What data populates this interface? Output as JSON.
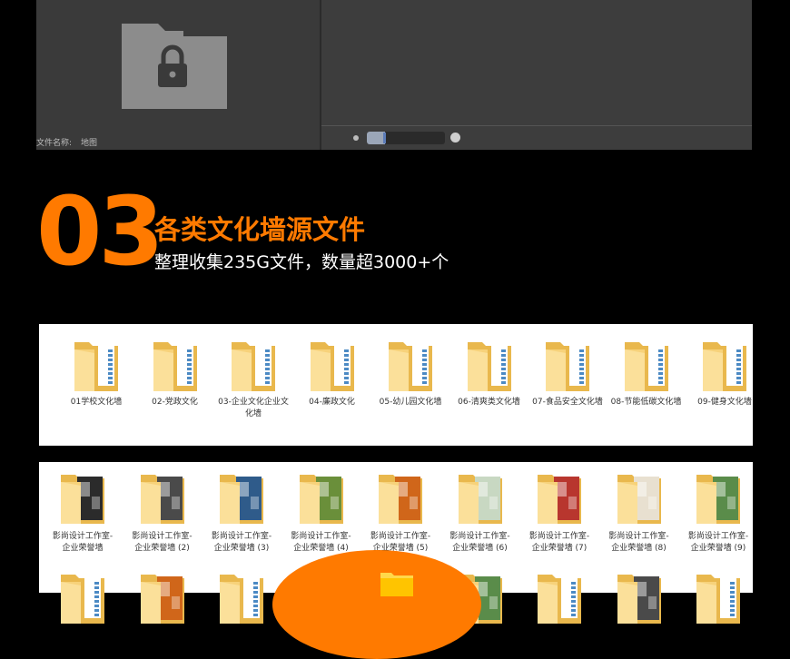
{
  "preview": {
    "filename_label": "文件名称:",
    "filename_value": "地图"
  },
  "heading": {
    "number": "03",
    "title": "各类文化墙源文件",
    "subtitle": "整理收集235G文件，数量超3000+个"
  },
  "panel1": {
    "items": [
      {
        "label": "01学校文化墙"
      },
      {
        "label": "02-党政文化"
      },
      {
        "label": "03-企业文化企业文化墙"
      },
      {
        "label": "04-廉政文化"
      },
      {
        "label": "05-幼儿园文化墙"
      },
      {
        "label": "06-清爽类文化墙"
      },
      {
        "label": "07-食品安全文化墙"
      },
      {
        "label": "08-节能低碳文化墙"
      },
      {
        "label": "09-健身文化墙"
      }
    ]
  },
  "panel2": {
    "items": [
      {
        "line1": "影尚设计工作室-",
        "line2": "企业荣誉墙"
      },
      {
        "line1": "影尚设计工作室-",
        "line2": "企业荣誉墙 (2)"
      },
      {
        "line1": "影尚设计工作室-",
        "line2": "企业荣誉墙 (3)"
      },
      {
        "line1": "影尚设计工作室-",
        "line2": "企业荣誉墙 (4)"
      },
      {
        "line1": "影尚设计工作室-",
        "line2": "企业荣誉墙 (5)"
      },
      {
        "line1": "影尚设计工作室-",
        "line2": "企业荣誉墙 (6)"
      },
      {
        "line1": "影尚设计工作室-",
        "line2": "企业荣誉墙 (7)"
      },
      {
        "line1": "影尚设计工作室-",
        "line2": "企业荣誉墙 (8)"
      },
      {
        "line1": "影尚设计工作室-",
        "line2": "企业荣誉墙 (9)"
      }
    ]
  },
  "colors": {
    "accent": "#ff7a00",
    "folder": "#f7d27a"
  }
}
